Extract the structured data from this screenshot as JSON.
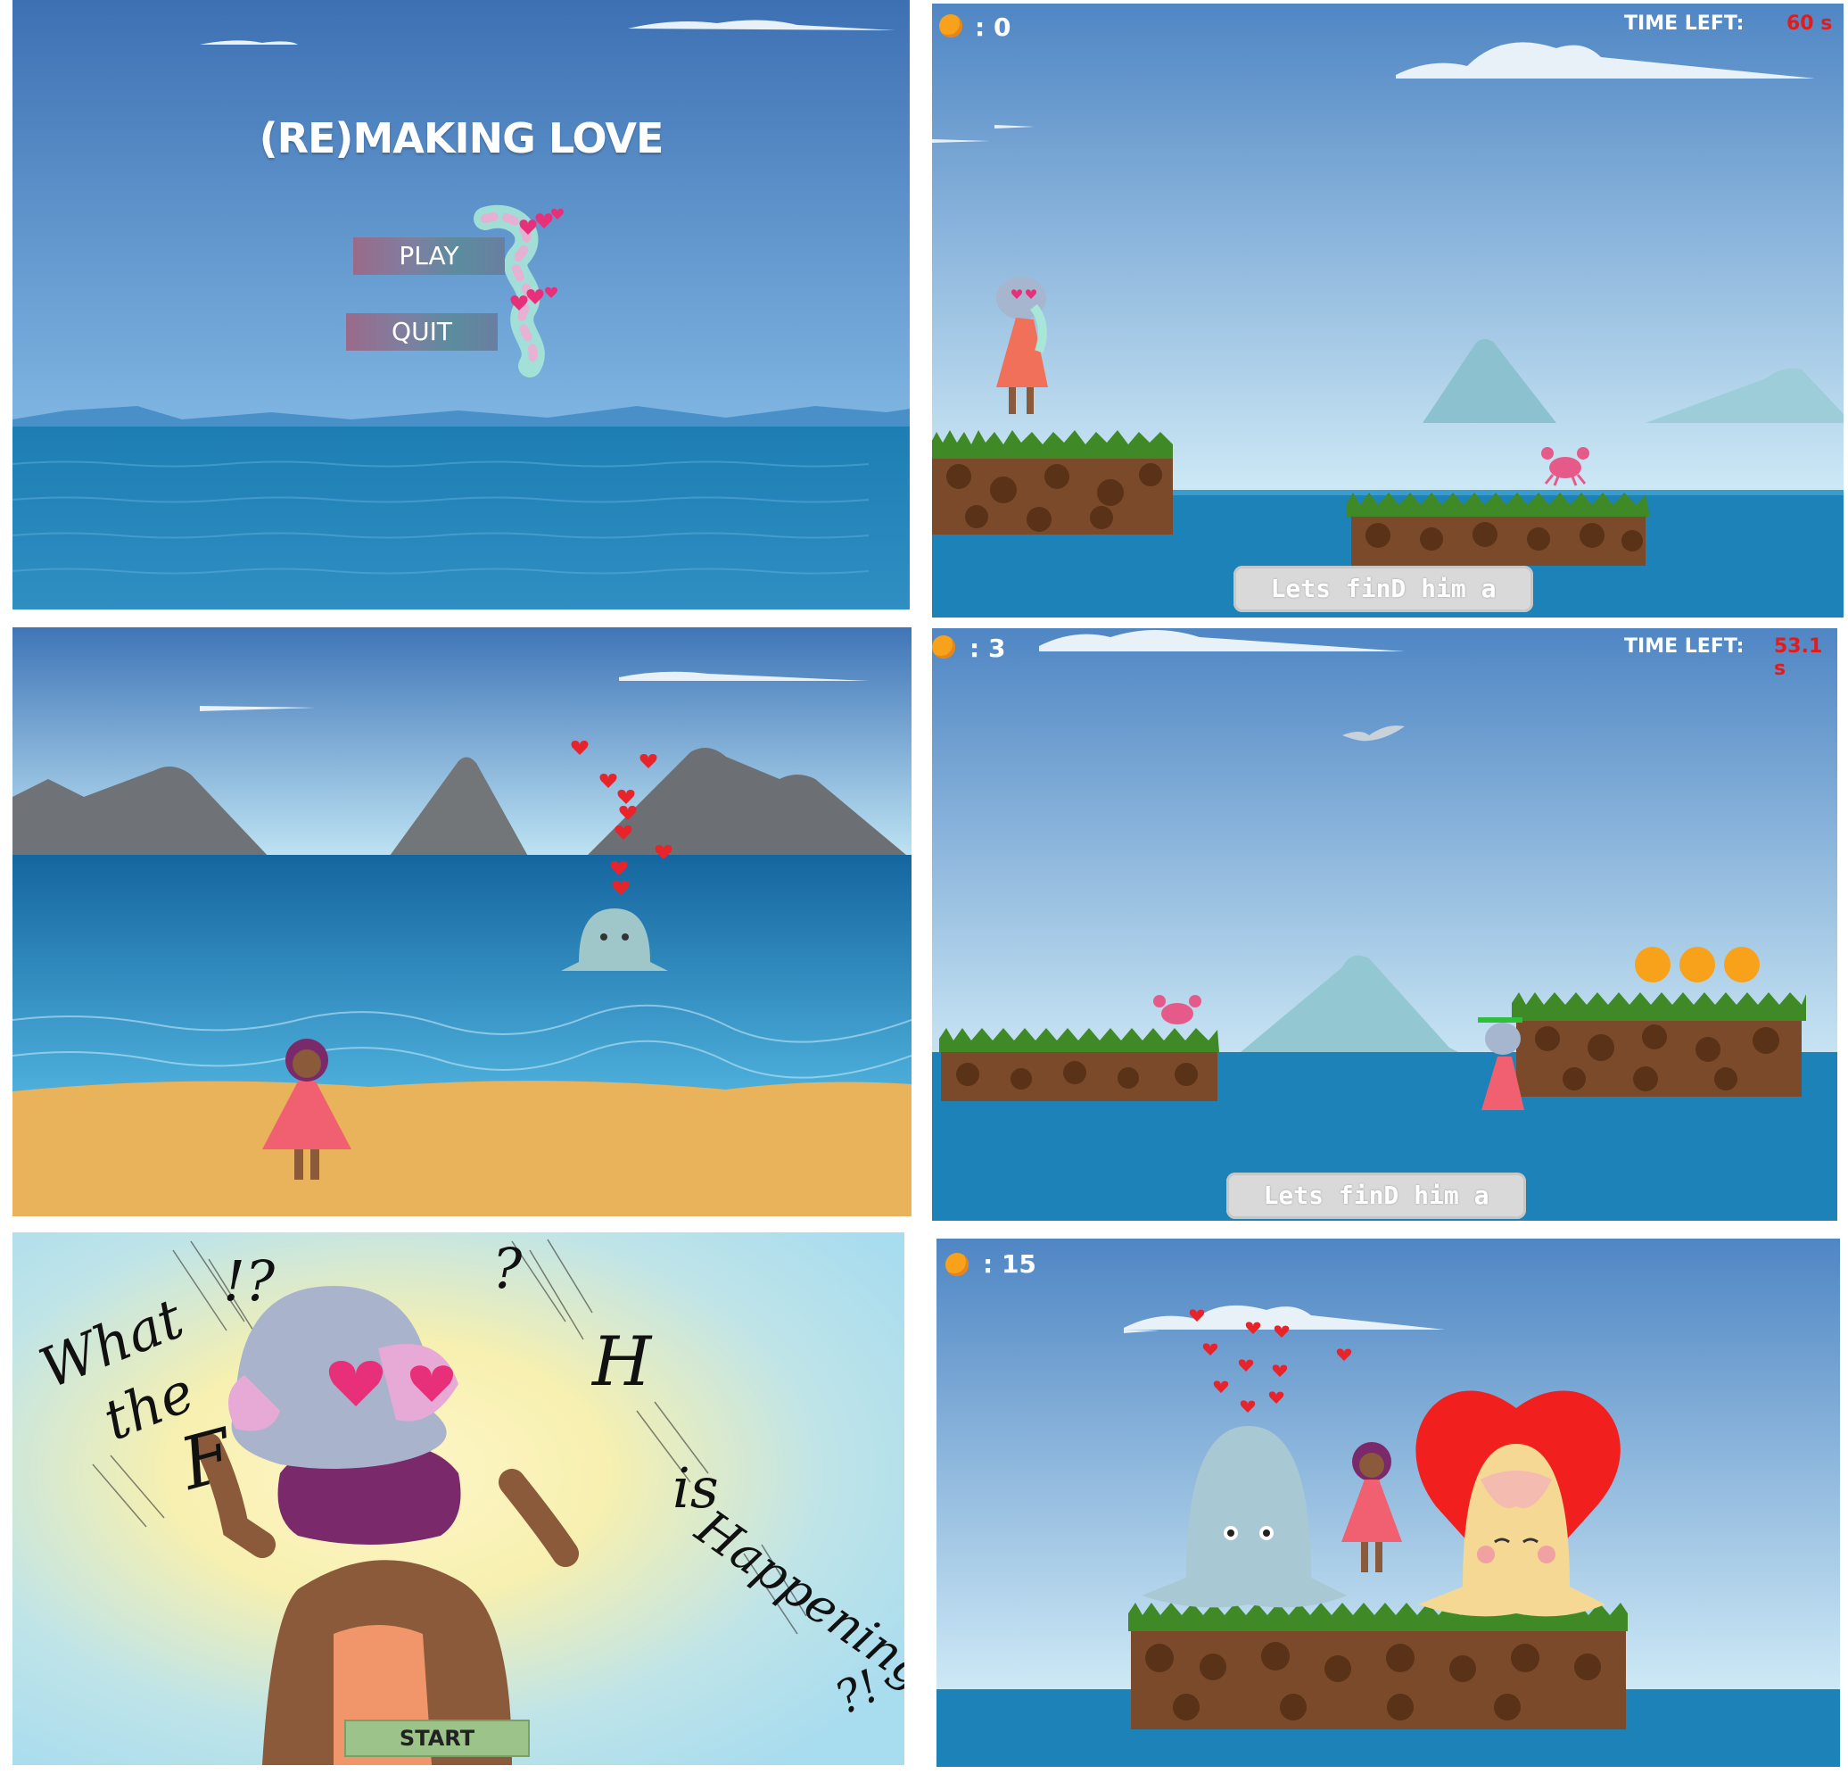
{
  "main_menu": {
    "title": "(RE)MAKING LOVE",
    "play_label": "PLAY",
    "quit_label": "QUIT"
  },
  "level_start": {
    "coins": ": 0",
    "time_label": "TIME LEFT:",
    "time_value": "60 s",
    "dialog": "Lets finD him a mate"
  },
  "level_mid": {
    "coins": ": 3",
    "time_label": "TIME LEFT:",
    "time_value": "53.1 s",
    "dialog": "Lets finD him a mate"
  },
  "cutscene": {
    "words": [
      "What",
      "the",
      "F",
      "!?",
      "?",
      "H",
      "is",
      "Happening",
      "?!"
    ],
    "start_label": "START"
  },
  "ending": {
    "coins": ": 15"
  },
  "colors": {
    "coin": "#f7a21a",
    "timer_value": "#e51a1a",
    "heart": "#e8232a",
    "sky_top": "#3f73b6",
    "sea": "#1b7db0"
  },
  "icons": [
    "coin-icon",
    "heart-icon",
    "crab-sprite",
    "seagull-sprite",
    "octopus-sprite",
    "player-sprite"
  ]
}
